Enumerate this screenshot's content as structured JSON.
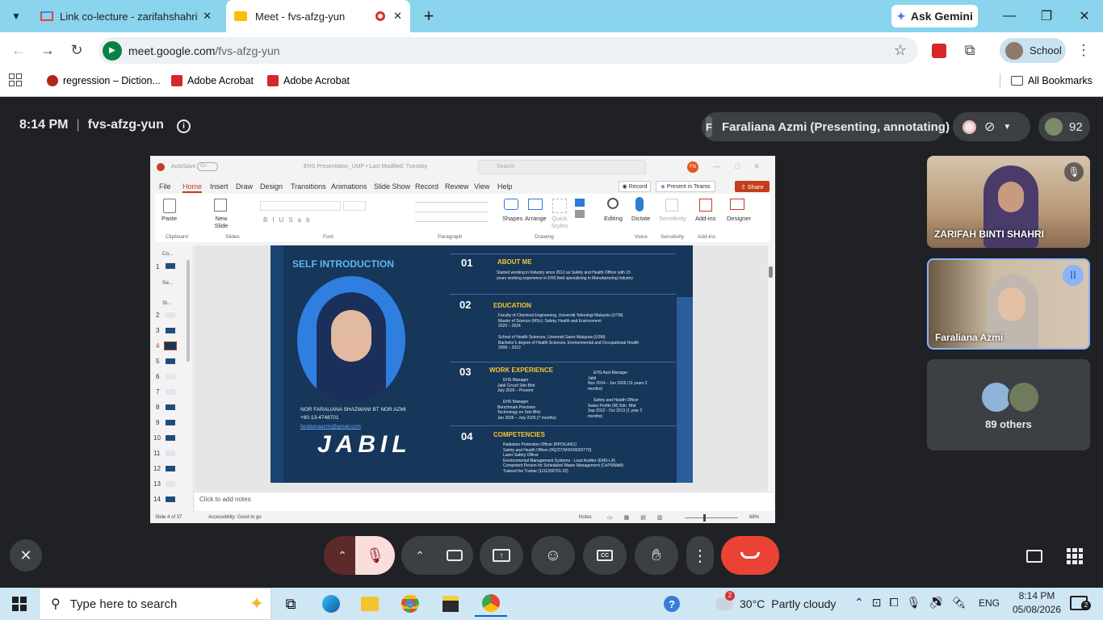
{
  "browser": {
    "tabs": [
      {
        "title": "Link co-lecture - zarifahshahri@",
        "active": false
      },
      {
        "title": "Meet - fvs-afzg-yun",
        "active": true
      }
    ],
    "ask_gemini": "Ask Gemini",
    "url_host": "meet.google.com",
    "url_path": "/fvs-afzg-yun",
    "profile_label": "School",
    "bookmarks": [
      "regression – Diction...",
      "Adobe Acrobat",
      "Adobe Acrobat"
    ],
    "all_bookmarks": "All Bookmarks"
  },
  "meet": {
    "time": "8:14 PM",
    "separator": "|",
    "meeting_code": "fvs-afzg-yun",
    "presenter_chip": "Faraliana Azmi (Presenting, annotating)",
    "presenter_initial": "F",
    "participant_count": "92",
    "participants": [
      {
        "name": "ZARIFAH BINTI SHAHRI",
        "muted": true
      },
      {
        "name": "Faraliana Azmi",
        "speaking": true
      }
    ],
    "others_label": "89 others",
    "accent_color": "#8ab4f8",
    "end_call_color": "#ea4335",
    "mic_off_color": "#f9dedc"
  },
  "ppt": {
    "autosave": "AutoSave",
    "autosave_state": "On",
    "doc_title": "EHS Presentation_UMP • Last Modified: Tuesday",
    "search_placeholder": "Search",
    "user_initials": "FN",
    "menu_tabs": [
      "File",
      "Home",
      "Insert",
      "Draw",
      "Design",
      "Transitions",
      "Animations",
      "Slide Show",
      "Record",
      "Review",
      "View",
      "Help"
    ],
    "record_btn": "Record",
    "teams_btn": "Present in Teams",
    "share_btn": "Share",
    "ribbon_items": [
      "Paste",
      "New Slide",
      "Shapes",
      "Arrange",
      "Quick Styles",
      "Editing",
      "Dictate",
      "Sensitivity",
      "Add-ins",
      "Designer"
    ],
    "ribbon_groups": [
      "Clipboard",
      "Slides",
      "Font",
      "Paragraph",
      "Drawing",
      "Voice",
      "Sensitivity",
      "Add-ins"
    ],
    "thumb_sections": [
      "Co...",
      "Se...",
      "Sl..."
    ],
    "thumb_numbers": [
      "1",
      "2",
      "3",
      "4",
      "5",
      "6",
      "7",
      "8",
      "9",
      "10",
      "11",
      "12",
      "13",
      "14"
    ],
    "notes_placeholder": "Click to add notes",
    "status_left": "Slide 4 of 37",
    "status_accessibility": "Accessibility: Good to go",
    "notes_btn": "Notes",
    "zoom": "68%",
    "slide": {
      "title": "SELF INTRODUCTION",
      "person_name": "NOR FARALIANA SHAZWANI BT NOR AZMI",
      "phone": "+60 13-4748701",
      "email": "faralianaazmi@gmail.com",
      "logo": "JABIL",
      "sections": [
        {
          "num": "01",
          "heading": "ABOUT ME",
          "lines": [
            "Started working in Industry since 2012 as Safety and Health Officer with 15",
            "years working experience in EHS field specializing in Manufacturing Industry"
          ]
        },
        {
          "num": "02",
          "heading": "EDUCATION",
          "lines": [
            "Faculty of Chemical Engineering, Universiti Teknologi Malaysia (UTM)",
            "Master of Science (MSc): Safety, Health and Environment",
            "2020 – 2024",
            "School of Health Sciences, Universiti Sains Malaysia (USM)",
            "Bachelor's degree of Health Sciences, Environmental and Occupational Health",
            "2008 – 2012"
          ]
        },
        {
          "num": "03",
          "heading": "WORK EXPERIENCE",
          "col1": [
            "EHS Manager",
            "Jabil Circuit Sdn Bhd",
            "July 2026 – Present",
            "EHS Manager",
            "Benchmark Precision",
            "Technology en Sdn Bhd",
            "Jan 2026 – July 2026 (7 months)"
          ],
          "col2": [
            "EHS Asst Manager",
            "Jabil",
            "Nov 2014 – Jun 2026 (11 years 2",
            "months)",
            "Safety and Health Officer",
            "Swiss Profile (M) Sdn. Bhd",
            "Sep 2012 - Oct 2013 (1 year 2",
            "months)"
          ]
        },
        {
          "num": "04",
          "heading": "COMPETENCIES",
          "lines": [
            "Radiation Protection Officer (RPO/LA/61)",
            "Safety and Health Officer (HQ/27/SHO/00/02770)",
            "Laser Safety Officer",
            "Environmental Management Systems - Lead Auditor (EMS-LA)",
            "Competent Person for Scheduled Waste Management (CePSWaM)",
            "Trained the Trainer (1111200701-22)"
          ]
        }
      ]
    }
  },
  "taskbar": {
    "search_placeholder": "Type here to search",
    "weather_temp": "30°C",
    "weather_desc": "Partly cloudy",
    "weather_badge": "2",
    "language": "ENG",
    "clock_time": "8:14 PM",
    "clock_date": "05/08/2026",
    "notif_count": "2"
  }
}
